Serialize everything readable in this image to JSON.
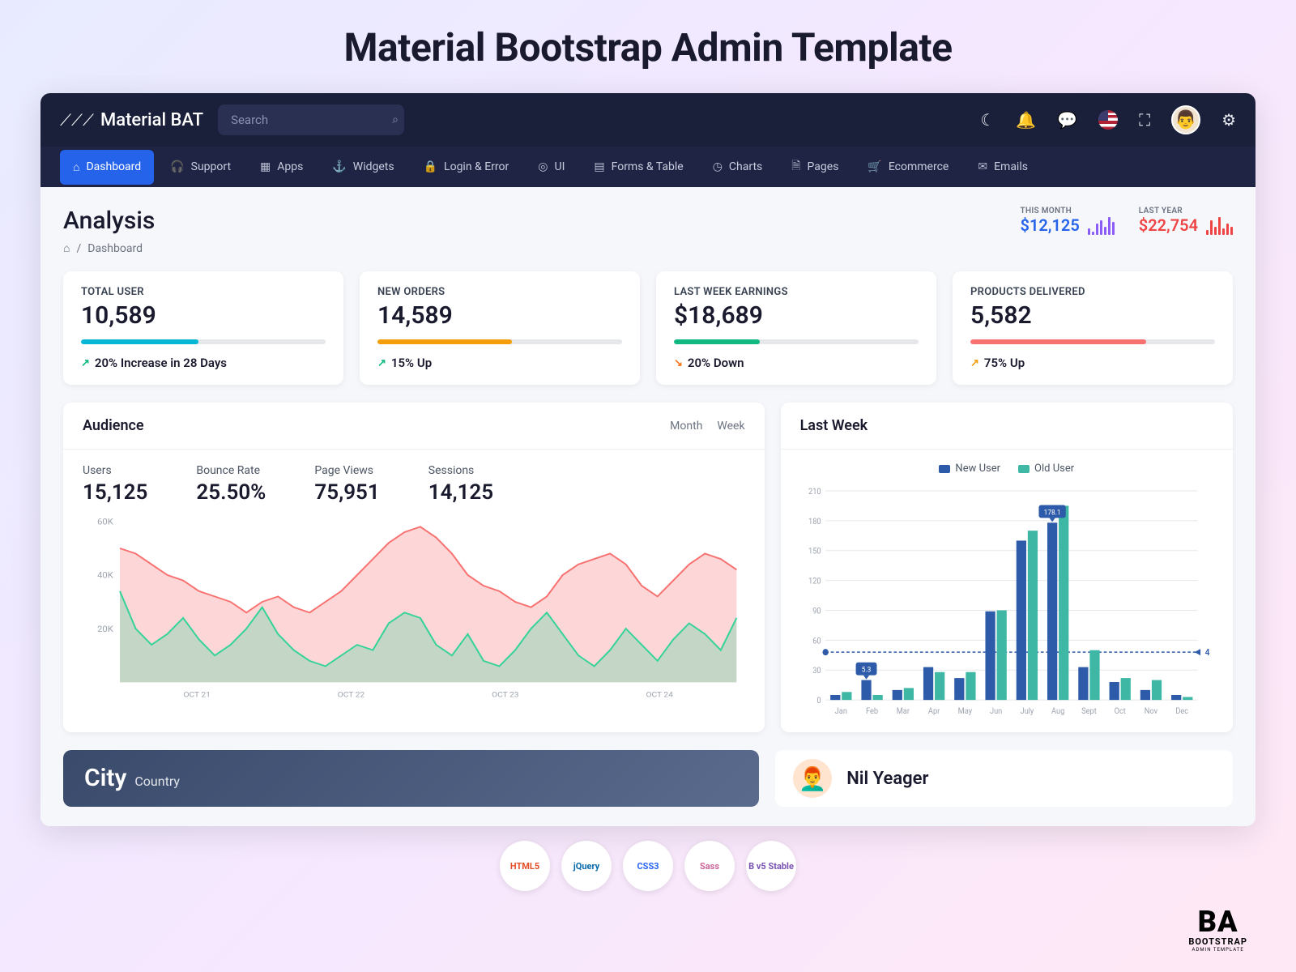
{
  "promo_title": "Material Bootstrap Admin Template",
  "brand": "Material BAT",
  "search_placeholder": "Search",
  "nav": [
    {
      "icon": "⌂",
      "label": "Dashboard",
      "active": true
    },
    {
      "icon": "🎧",
      "label": "Support"
    },
    {
      "icon": "▦",
      "label": "Apps"
    },
    {
      "icon": "⚓",
      "label": "Widgets"
    },
    {
      "icon": "🔒",
      "label": "Login & Error"
    },
    {
      "icon": "◎",
      "label": "UI"
    },
    {
      "icon": "▤",
      "label": "Forms & Table"
    },
    {
      "icon": "◷",
      "label": "Charts"
    },
    {
      "icon": "🗎",
      "label": "Pages"
    },
    {
      "icon": "🛒",
      "label": "Ecommerce"
    },
    {
      "icon": "✉",
      "label": "Emails"
    }
  ],
  "page_title": "Analysis",
  "breadcrumb": "Dashboard",
  "head_stats": {
    "month_label": "THIS MONTH",
    "month_value": "$12,125",
    "year_label": "LAST YEAR",
    "year_value": "$22,754"
  },
  "kpi": [
    {
      "label": "TOTAL USER",
      "value": "10,589",
      "color": "#06b6d4",
      "pct": 48,
      "trend_icon": "↗",
      "trend_color": "#10b981",
      "trend": "20% Increase in 28 Days"
    },
    {
      "label": "NEW ORDERS",
      "value": "14,589",
      "color": "#f59e0b",
      "pct": 55,
      "trend_icon": "↗",
      "trend_color": "#10b981",
      "trend": "15% Up"
    },
    {
      "label": "LAST WEEK EARNINGS",
      "value": "$18,689",
      "color": "#10b981",
      "pct": 35,
      "trend_icon": "↘",
      "trend_color": "#f97316",
      "trend": "20% Down"
    },
    {
      "label": "PRODUCTS DELIVERED",
      "value": "5,582",
      "color": "#f87171",
      "pct": 72,
      "trend_icon": "↗",
      "trend_color": "#f59e0b",
      "trend": "75% Up"
    }
  ],
  "audience": {
    "title": "Audience",
    "tabs": [
      "Month",
      "Week"
    ],
    "metrics": [
      {
        "label": "Users",
        "value": "15,125"
      },
      {
        "label": "Bounce Rate",
        "value": "25.50%"
      },
      {
        "label": "Page Views",
        "value": "75,951"
      },
      {
        "label": "Sessions",
        "value": "14,125"
      }
    ],
    "xticks": [
      "OCT 21",
      "OCT 22",
      "OCT 23",
      "OCT 24"
    ]
  },
  "lastweek": {
    "title": "Last Week",
    "legend": [
      {
        "label": "New User",
        "color": "#2d5ba9"
      },
      {
        "label": "Old User",
        "color": "#3eb8a5"
      }
    ],
    "tooltip_a": "5.3",
    "tooltip_b": "178.1",
    "guideline": "4"
  },
  "chart_data": [
    {
      "type": "area",
      "title": "Audience",
      "ylabel": "",
      "ylim": [
        0,
        60000
      ],
      "yticks": [
        "60K",
        "40K",
        "20K"
      ],
      "xticks": [
        "OCT 21",
        "OCT 22",
        "OCT 23",
        "OCT 24"
      ],
      "series": [
        {
          "name": "series-a",
          "color": "#f87171",
          "values": [
            50000,
            48000,
            44000,
            40000,
            38000,
            34000,
            32000,
            30000,
            26000,
            30000,
            32000,
            28000,
            26000,
            30000,
            34000,
            40000,
            46000,
            52000,
            56000,
            58000,
            54000,
            48000,
            40000,
            36000,
            34000,
            30000,
            28000,
            32000,
            40000,
            44000,
            46000,
            48000,
            44000,
            36000,
            32000,
            38000,
            44000,
            48000,
            46000,
            42000
          ]
        },
        {
          "name": "series-b",
          "color": "#34d399",
          "values": [
            34000,
            20000,
            14000,
            18000,
            24000,
            16000,
            10000,
            14000,
            20000,
            28000,
            18000,
            12000,
            8000,
            6000,
            10000,
            14000,
            12000,
            22000,
            26000,
            24000,
            14000,
            10000,
            18000,
            8000,
            6000,
            12000,
            20000,
            26000,
            18000,
            10000,
            6000,
            12000,
            20000,
            14000,
            8000,
            16000,
            22000,
            18000,
            12000,
            24000
          ]
        }
      ]
    },
    {
      "type": "bar",
      "title": "Last Week",
      "ylim": [
        0,
        210
      ],
      "yticks": [
        0,
        30,
        60,
        90,
        120,
        150,
        180,
        210
      ],
      "categories": [
        "Jan",
        "Feb",
        "Mar",
        "Apr",
        "May",
        "Jun",
        "July",
        "Aug",
        "Sept",
        "Oct",
        "Nov",
        "Dec"
      ],
      "series": [
        {
          "name": "New User",
          "color": "#2d5ba9",
          "values": [
            5,
            20,
            10,
            33,
            22,
            89,
            160,
            178,
            33,
            18,
            10,
            5
          ]
        },
        {
          "name": "Old User",
          "color": "#3eb8a5",
          "values": [
            8,
            5,
            12,
            28,
            28,
            90,
            170,
            195,
            50,
            22,
            20,
            3
          ]
        }
      ],
      "guideline_y": 48,
      "guideline_label": "4"
    }
  ],
  "city": {
    "title": "City",
    "sub": "Country"
  },
  "profile": {
    "name": "Nil Yeager"
  },
  "tech_badges": [
    "HTML5",
    "jQuery",
    "CSS3",
    "Sass",
    "B v5 Stable"
  ],
  "footer_brand": {
    "big": "BA",
    "small": "BOOTSTRAP",
    "tiny": "ADMIN TEMPLATE"
  }
}
